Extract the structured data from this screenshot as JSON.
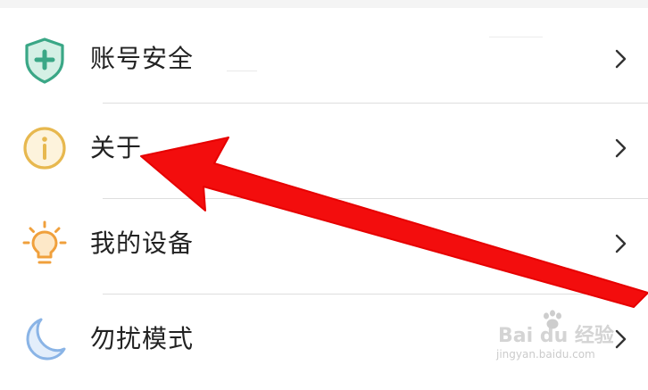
{
  "menu": {
    "items": [
      {
        "label": "账号安全",
        "icon": "shield-plus-icon",
        "icon_color": "#3aa786"
      },
      {
        "label": "关于",
        "icon": "info-circle-icon",
        "icon_color": "#e7b84f"
      },
      {
        "label": "我的设备",
        "icon": "lightbulb-icon",
        "icon_color": "#f0a03c"
      },
      {
        "label": "勿扰模式",
        "icon": "crescent-moon-icon",
        "icon_color": "#8ab4e6"
      }
    ],
    "chevron_icon": "chevron-right-icon"
  },
  "annotation": {
    "type": "red-arrow",
    "points_to": "关于",
    "color": "#f30d0d"
  },
  "watermark": {
    "main": "Bai du 经验",
    "sub": "jingyan.baidu.com"
  }
}
